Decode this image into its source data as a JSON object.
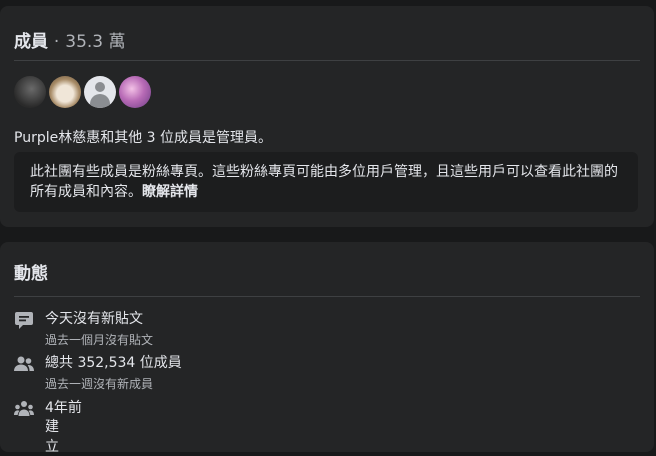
{
  "members_section": {
    "title": "成員",
    "separator": "·",
    "count": "35.3 萬",
    "admins_text": "Purple林慈惠和其他 3 位成員是管理員。",
    "notice_text": "此社團有些成員是粉絲專頁。這些粉絲專頁可能由多位用戶管理，且這些用戶可以查看此社團的所有成員和內容。",
    "notice_link": "瞭解詳情"
  },
  "activity_section": {
    "title": "動態",
    "rows": [
      {
        "icon": "chat-bubble-icon",
        "main": "今天沒有新貼文",
        "sub": "過去一個月沒有貼文"
      },
      {
        "icon": "people-icon",
        "main": "總共 352,534 位成員",
        "sub": "過去一週沒有新成員"
      },
      {
        "icon": "group-icon",
        "main": "4年前",
        "sub": "建立"
      }
    ]
  },
  "colors": {
    "background": "#18191a",
    "card": "#242526",
    "text_primary": "#e4e6eb",
    "text_secondary": "#b0b3b8"
  }
}
